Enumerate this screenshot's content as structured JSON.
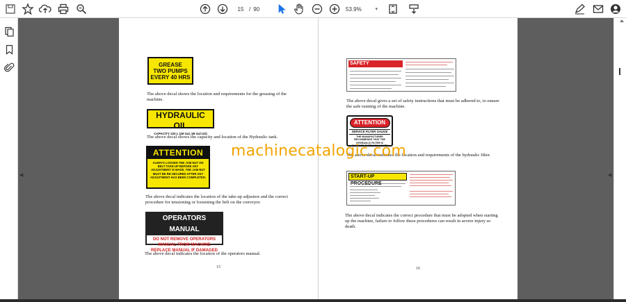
{
  "toolbar": {
    "current_page": "15",
    "page_separator": "/",
    "total_pages": "90",
    "zoom": "53.9%",
    "zoom_caret": "▾"
  },
  "watermark": "machinecatalogic.com",
  "left_page": {
    "decal_grease": [
      "GREASE",
      "TWO PUMPS",
      "EVERY 40 HRS"
    ],
    "caption_grease": "The above decal shows the location and requirements for the greasing of the machine.",
    "decal_hydraulic_title": "HYDRAULIC OIL",
    "decal_hydraulic_sub": "CAPACITY 220 L (49 Gal, 58 Gal US)",
    "caption_hydraulic": "The above decal shows the capacity and location of the Hydraulic tank.",
    "decal_attention_title": "ATTENTION",
    "decal_attention_body": "ALWAYS LOOSEN THE JAM NUT ON BELT TAKE-UP BEFORE ANY ADJUSTMENT IS MADE. THE JAM NUT MUST BE RE-SECURED AFTER ANY ADJUSTMENT HAS BEEN COMPLETED.",
    "caption_attention": "The above decal indicates the location of the take-up adjusters and the correct procedure for tensioning or loosening the belt on the conveyor.",
    "decal_manual_title": "OPERATORS MANUAL",
    "decal_manual_body": [
      "DO NOT REMOVE OPERATORS",
      "MANUAL FROM MACHINE",
      "REPLACE MANUAL IF DAMAGED"
    ],
    "caption_manual": "The above decal indicates the location of the operators manual.",
    "page_number": "15"
  },
  "right_page": {
    "decal_safety_title": "SAFETY INSTRUCTIONS",
    "caption_safety": "The above decal gives a set of safety instructions that must be adhered to, to ensure the safe running of the machine.",
    "decal_attention_title": "ATTENTION",
    "decal_attention_sub": "SERVICE FILTER GAUGE",
    "decal_attention_body": "THE MANUFACTURER RECOMMENDS THAT THE HYDRAULIC FILTER IS CHANGED EVERY 500 HOURS",
    "caption_filter": "The above decal indicates the location and requirements of the hydraulic filter.",
    "decal_startup_title": "START-UP PROCEDURE",
    "caption_startup": "The above decal indicates the correct procedure that must be adopted when starting up the machine, failure to follow these procedures can result in severe injury so death.",
    "page_number": "16"
  },
  "colors": {
    "decal_yellow": "#f7e600",
    "decal_red": "#d9232a",
    "watermark": "#f2a400",
    "viewer_background": "#5e5e5e"
  },
  "icons": [
    "save-icon",
    "bookmark-star-icon",
    "upload-icon",
    "print-icon",
    "zoom-search-icon",
    "page-up-icon",
    "page-down-icon",
    "select-cursor-icon",
    "hand-tool-icon",
    "zoom-out-icon",
    "zoom-in-icon",
    "page-fit-icon",
    "scroll-mode-icon",
    "sign-icon",
    "mail-icon",
    "account-icon",
    "pages-panel-icon",
    "bookmarks-icon",
    "attachments-icon"
  ]
}
